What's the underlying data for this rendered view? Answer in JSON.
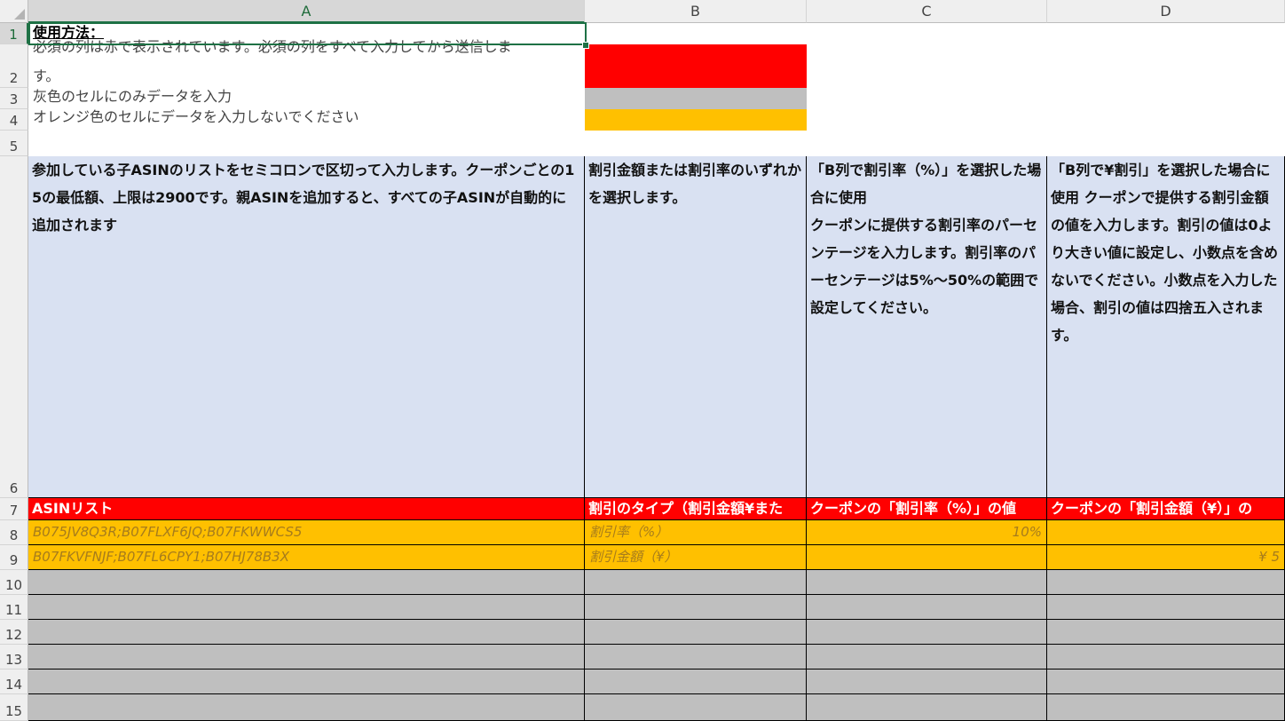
{
  "columns": [
    "A",
    "B",
    "C",
    "D"
  ],
  "rows": [
    "1",
    "2",
    "3",
    "4",
    "5",
    "6",
    "7",
    "8",
    "9",
    "10",
    "11",
    "12",
    "13",
    "14",
    "15"
  ],
  "instructions": {
    "title": "使用方法：",
    "line_red_a": "必須の列は赤で表示されています。必須の列をすべて入力してから送信しま",
    "line_red_b": "す。",
    "line_gray": "灰色のセルにのみデータを入力",
    "line_orange": "オレンジ色のセルにデータを入力しないでください"
  },
  "legend_colors": {
    "red": "#ff0000",
    "gray": "#bfbfbf",
    "orange": "#ffc000"
  },
  "descriptions": {
    "a": "参加している子ASINのリストをセミコロンで区切って入力します。クーポンごとの15の最低額、上限は2900です。親ASINを追加すると、すべての子ASINが自動的に追加されます",
    "b": "割引金額または割引率のいずれかを選択します。",
    "c": "「B列で割引率（%）」を選択した場合に使用\nクーポンに提供する割引率のパーセンテージを入力します。割引率のパーセンテージは5%〜50%の範囲で設定してください。",
    "d": "「B列で¥割引」を選択した場合に使用 クーポンで提供する割引金額の値を入力します。割引の値は0より大きい値に設定し、小数点を含めないでください。小数点を入力した場合、割引の値は四捨五入されます。"
  },
  "headers": {
    "a": "ASINリスト",
    "b": "割引のタイプ（割引金額¥また",
    "c": "クーポンの「割引率（%）」の値",
    "d": "クーポンの「割引金額（¥）」の"
  },
  "examples": [
    {
      "a": "B075JV8Q3R;B07FLXF6JQ;B07FKWWCS5",
      "b": "割引率（%）",
      "c": "10%",
      "d": ""
    },
    {
      "a": "B07FKVFNJF;B07FL6CPY1;B07HJ78B3X",
      "b": "割引金額（¥）",
      "c": "",
      "d": "¥ 5"
    }
  ]
}
